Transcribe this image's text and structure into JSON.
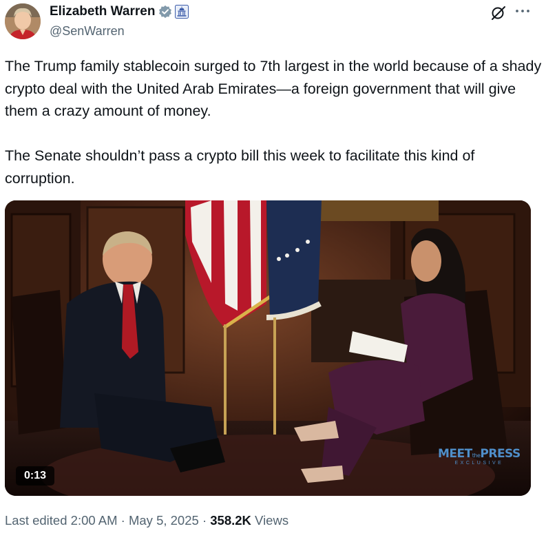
{
  "author": {
    "name": "Elizabeth Warren",
    "handle": "@SenWarren",
    "verified_badge_color": "#829aab",
    "gov_badge_color": "#3b5ba9"
  },
  "post": {
    "paragraph_1": "The Trump family stablecoin surged to 7th largest in the world because of a shady crypto deal with the United Arab Emirates—a foreign government that will give them a crazy amount of money.",
    "paragraph_2": "The Senate shouldn’t pass a crypto bill this week to facilitate this kind of corruption."
  },
  "video": {
    "duration": "0:13",
    "logo_main_left": "MEET",
    "logo_main_mid": "the",
    "logo_main_right": "PRESS",
    "logo_sub": "EXCLUSIVE"
  },
  "meta": {
    "edited_label": "Last edited 2:00 AM",
    "separator": " · ",
    "date": "May 5, 2025",
    "views_count": "358.2K",
    "views_label": " Views"
  },
  "icons": {
    "more": "more-options-icon",
    "grok": "grok-icon",
    "verified": "verified-badge-icon",
    "government": "government-capitol-icon"
  }
}
